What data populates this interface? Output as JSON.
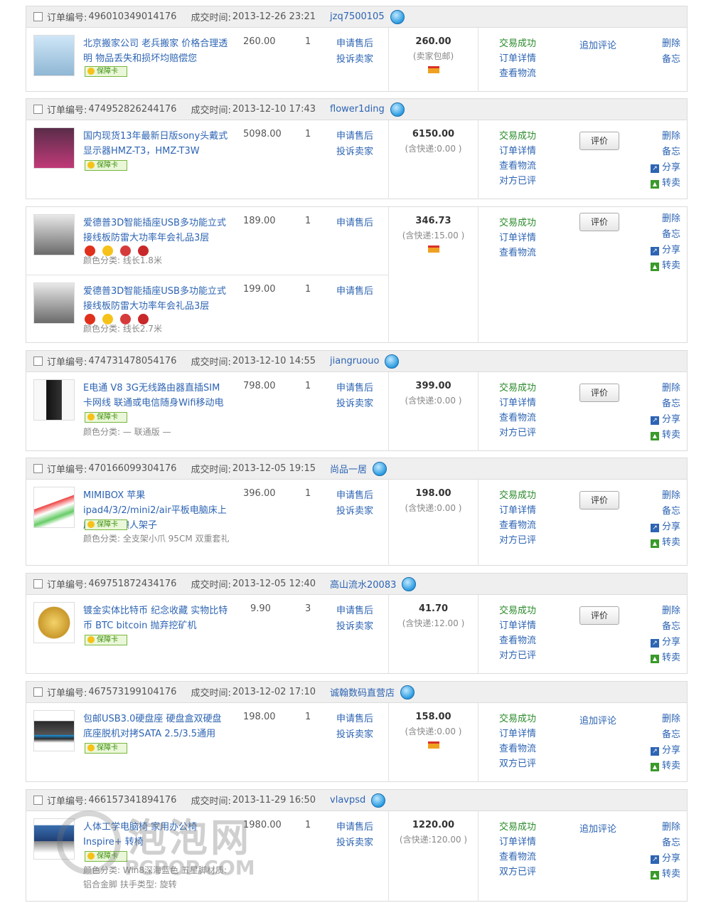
{
  "labels": {
    "order_no": "订单编号:",
    "deal_time": "成交时间:",
    "after_sale": "申请售后",
    "complain": "投诉卖家",
    "trade_ok": "交易成功",
    "order_detail": "订单详情",
    "view_logistics": "查看物流",
    "rated": "对方已评",
    "rated2": "双方已评",
    "review": "评价",
    "add_review": "追加评论",
    "delete": "删除",
    "note": "备忘",
    "share": "分享",
    "resell": "转卖",
    "guarantee": "保障卡"
  },
  "orders": [
    {
      "order_no": "496010349014176",
      "time": "2013-12-26 23:21",
      "seller": "jzq7500105",
      "total": "260.00",
      "total_sub": "(卖家包邮)",
      "has_card": true,
      "items": [
        {
          "title": "北京搬家公司 老兵搬家 价格合理透明 物品丢失和损坏均赔偿您",
          "price": "260.00",
          "qty": "1",
          "attr": ""
        }
      ]
    },
    {
      "order_no": "474952826244176",
      "time": "2013-12-10 17:43",
      "seller": "flower1ding",
      "total": "6150.00",
      "total_sub": "(含快递:0.00 )",
      "items": [
        {
          "title": "国内现货13年最新日版sony头戴式显示器HMZ-T3，HMZ-T3W",
          "price": "5098.00",
          "qty": "1",
          "attr": ""
        }
      ]
    },
    {
      "order_no": "",
      "time": "",
      "seller": "",
      "total": "346.73",
      "total_sub": "(含快递:15.00 )",
      "has_card": true,
      "items": [
        {
          "title": "爱德普3D智能插座USB多功能立式接线板防雷大功率年会礼品3层",
          "price": "189.00",
          "qty": "1",
          "attr": "颜色分类: 线长1.8米"
        },
        {
          "title": "爱德普3D智能插座USB多功能立式接线板防雷大功率年会礼品3层",
          "price": "199.00",
          "qty": "1",
          "attr": "颜色分类: 线长2.7米"
        }
      ]
    },
    {
      "order_no": "474731478054176",
      "time": "2013-12-10 14:55",
      "seller": "jiangruouo",
      "total": "399.00",
      "total_sub": "(含快递:0.00 )",
      "items": [
        {
          "title": "E电通 V8 3G无线路由器直插SIM卡网线 联通或电信随身Wifi移动电",
          "price": "798.00",
          "qty": "1",
          "attr": "颜色分类: — 联通版 —"
        }
      ]
    },
    {
      "order_no": "470166099304176",
      "time": "2013-12-05 19:15",
      "seller": "尚品一居",
      "total": "198.00",
      "total_sub": "(含快递:0.00 )",
      "items": [
        {
          "title": "MIMIBOX 苹果ipad4/3/2/mini2/air平板电脑床上床头支架懒人架子",
          "price": "396.00",
          "qty": "1",
          "attr": "颜色分类: 全支架小爪 95CM 双重套礼"
        }
      ]
    },
    {
      "order_no": "469751872434176",
      "time": "2013-12-05 12:40",
      "seller": "高山流水20083",
      "total": "41.70",
      "total_sub": "(含快递:12.00 )",
      "items": [
        {
          "title": "镀金实体比特币 纪念收藏 实物比特币 BTC bitcoin 抛弃挖矿机",
          "price": "9.90",
          "qty": "3",
          "attr": ""
        }
      ]
    },
    {
      "order_no": "467573199104176",
      "time": "2013-12-02 17:10",
      "seller": "诚翰数码直营店",
      "total": "158.00",
      "total_sub": "(含快递:0.00 )",
      "has_card": true,
      "items": [
        {
          "title": "包邮USB3.0硬盘座 硬盘盒双硬盘底座脱机对拷SATA 2.5/3.5通用",
          "price": "198.00",
          "qty": "1",
          "attr": ""
        }
      ]
    },
    {
      "order_no": "466157341894176",
      "time": "2013-11-29 16:50",
      "seller": "vlavpsd",
      "total": "1220.00",
      "total_sub": "(含快递:120.00 )",
      "items": [
        {
          "title": "人体工学电脑椅 家用办公椅 Inspire+ 转椅",
          "price": "1980.00",
          "qty": "1",
          "attr": "颜色分类: Win8深海蓝色 五星脚材质: 铝合金脚 扶手类型: 旋转"
        }
      ]
    }
  ],
  "watermark": {
    "text": "泡泡网",
    "url": "PCPOP.COM"
  }
}
